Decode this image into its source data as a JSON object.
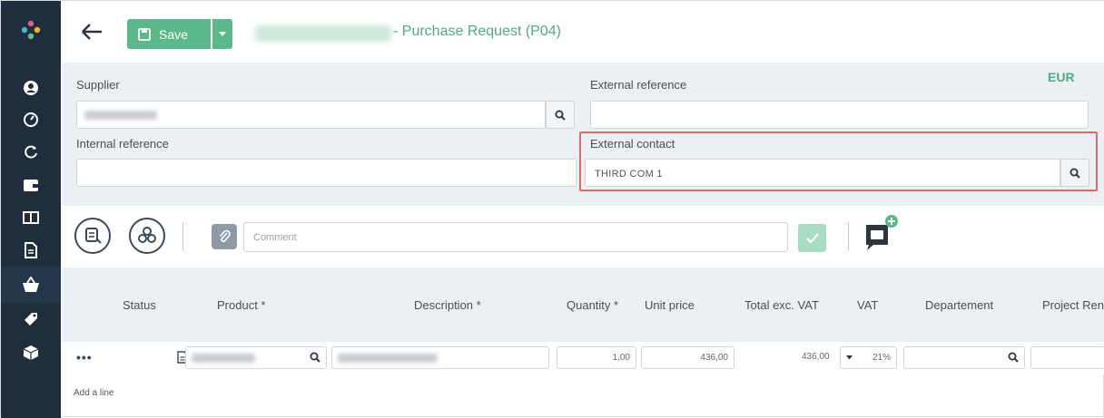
{
  "header": {
    "save_label": "Save",
    "title_suffix": "- Purchase Request (P04)"
  },
  "form": {
    "currency": "EUR",
    "supplier_label": "Supplier",
    "external_reference_label": "External reference",
    "external_reference_value": "",
    "internal_reference_label": "Internal reference",
    "internal_reference_value": "",
    "external_contact_label": "External contact",
    "external_contact_value": "THIRD COM 1"
  },
  "toolbar": {
    "comment_placeholder": "Comment"
  },
  "table": {
    "columns": [
      "Status",
      "Product *",
      "Description *",
      "Quantity *",
      "Unit price",
      "Total exc. VAT",
      "VAT",
      "Departement",
      "Project Ren"
    ],
    "row": {
      "quantity": "1,00",
      "unit_price": "436,00",
      "total_exc_vat": "436,00",
      "vat": "21%"
    },
    "add_line_label": "Add a line"
  },
  "icons": {
    "sidebar": [
      "logo-icon",
      "user-icon",
      "dashboard-icon",
      "refresh-icon",
      "wallet-icon",
      "book-icon",
      "document-icon",
      "basket-icon",
      "tag-icon",
      "box-icon"
    ]
  },
  "colors": {
    "sidebar_bg": "#1f2d3d",
    "accent_green": "#5cb88a",
    "title_green": "#4ead7e",
    "highlight_red": "#e0686a",
    "panel_bg": "#ebf0f2"
  }
}
